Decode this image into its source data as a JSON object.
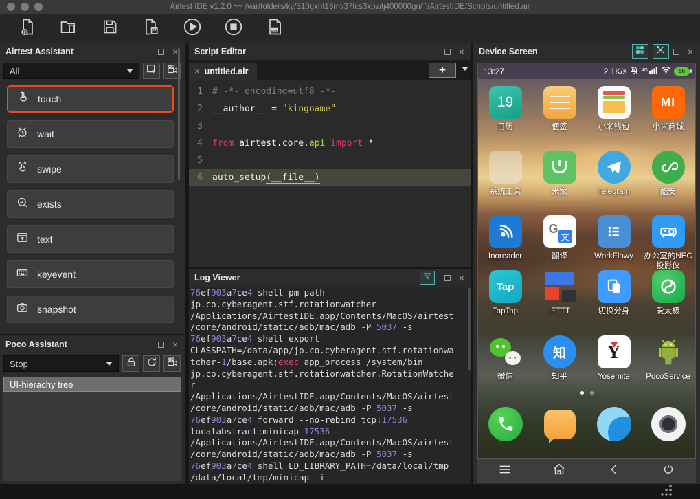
{
  "window": {
    "title": "Airtest IDE v1.2.0 ~~ /var/folders/ky/310gxhf13mv37tcs3xbwtj400000gn/T/AirtestIDE/Scripts/untitled.air"
  },
  "toolbar": {
    "buttons": [
      "new-script",
      "open-script",
      "save-script",
      "save-script-as",
      "run-script",
      "stop-script",
      "show-log"
    ]
  },
  "airtest_assistant": {
    "title": "Airtest Assistant",
    "filter_value": "All",
    "items": [
      {
        "label": "touch",
        "icon": "touch-icon",
        "highlighted": true
      },
      {
        "label": "wait",
        "icon": "wait-icon",
        "highlighted": false
      },
      {
        "label": "swipe",
        "icon": "swipe-icon",
        "highlighted": false
      },
      {
        "label": "exists",
        "icon": "exists-icon",
        "highlighted": false
      },
      {
        "label": "text",
        "icon": "text-icon",
        "highlighted": false
      },
      {
        "label": "keyevent",
        "icon": "keyevent-icon",
        "highlighted": false
      },
      {
        "label": "snapshot",
        "icon": "snapshot-icon",
        "highlighted": false
      }
    ]
  },
  "poco_assistant": {
    "title": "Poco Assistant",
    "mode_value": "Stop",
    "tree_header": "UI-hierachy tree"
  },
  "script_editor": {
    "title": "Script Editor",
    "tab_label": "untitled.air",
    "code": [
      {
        "num": "1",
        "current": false,
        "segs": [
          {
            "c": "cmt",
            "t": "# -*- encoding=utf8 -*-"
          }
        ]
      },
      {
        "num": "2",
        "current": false,
        "segs": [
          {
            "c": "pln",
            "t": "__author__ = "
          },
          {
            "c": "str",
            "t": "\"kingname\""
          }
        ]
      },
      {
        "num": "3",
        "current": false,
        "segs": []
      },
      {
        "num": "4",
        "current": false,
        "segs": [
          {
            "c": "kw",
            "t": "from"
          },
          {
            "c": "pln",
            "t": " airtest.core."
          },
          {
            "c": "fn",
            "t": "api"
          },
          {
            "c": "pln",
            "t": " "
          },
          {
            "c": "kw",
            "t": "import"
          },
          {
            "c": "pln",
            "t": " *"
          }
        ]
      },
      {
        "num": "5",
        "current": false,
        "segs": []
      },
      {
        "num": "6",
        "current": true,
        "segs": [
          {
            "c": "pln",
            "t": "auto_setup"
          },
          {
            "c": "pln u",
            "t": "(__file__)"
          }
        ]
      }
    ]
  },
  "log_viewer": {
    "title": "Log Viewer",
    "lines": [
      "76ef903a7ce4 shell pm path",
      "jp.co.cyberagent.stf.rotationwatcher",
      "/Applications/AirtestIDE.app/Contents/MacOS/airtest",
      "/core/android/static/adb/mac/adb -P 5037 -s",
      "76ef903a7ce4 shell export",
      "CLASSPATH=/data/app/jp.co.cyberagent.stf.rotationwa",
      "tcher-1/base.apk;exec app_process /system/bin",
      "jp.co.cyberagent.stf.rotationwatcher.RotationWatche",
      "r",
      "/Applications/AirtestIDE.app/Contents/MacOS/airtest",
      "/core/android/static/adb/mac/adb -P 5037 -s",
      "76ef903a7ce4 forward --no-rebind tcp:17536",
      "localabstract:minicap_17536",
      "/Applications/AirtestIDE.app/Contents/MacOS/airtest",
      "/core/android/static/adb/mac/adb -P 5037 -s",
      "76ef903a7ce4 shell LD_LIBRARY_PATH=/data/local/tmp",
      "/data/local/tmp/minicap -i"
    ]
  },
  "device_screen": {
    "title": "Device Screen",
    "status": {
      "time": "13:27",
      "net_speed": "2.1K/s",
      "network_label": "4G",
      "battery_percent": "56"
    },
    "app_rows": [
      [
        {
          "label": "日历",
          "icon": "calendar"
        },
        {
          "label": "便签",
          "icon": "notes"
        },
        {
          "label": "小米钱包",
          "icon": "mi-wallet"
        },
        {
          "label": "小米商城",
          "icon": "mi-store"
        }
      ],
      [
        {
          "label": "系统工具",
          "icon": "folder"
        },
        {
          "label": "米家",
          "icon": "mi-home"
        },
        {
          "label": "Telegram",
          "icon": "telegram"
        },
        {
          "label": "酷安",
          "icon": "coolapk"
        }
      ],
      [
        {
          "label": "Inoreader",
          "icon": "inoreader"
        },
        {
          "label": "翻译",
          "icon": "translate"
        },
        {
          "label": "WorkFlowy",
          "icon": "workflowy"
        },
        {
          "label": "办公室的NEC投影仪",
          "icon": "projector"
        }
      ],
      [
        {
          "label": "TapTap",
          "icon": "taptap"
        },
        {
          "label": "IFTTT",
          "icon": "ifttt"
        },
        {
          "label": "切换分身",
          "icon": "clone"
        },
        {
          "label": "爱太极",
          "icon": "taichi"
        }
      ],
      [
        {
          "label": "微信",
          "icon": "wechat"
        },
        {
          "label": "知乎",
          "icon": "zhihu"
        },
        {
          "label": "Yosemite",
          "icon": "yosemite"
        },
        {
          "label": "PocoService",
          "icon": "pocoservice"
        }
      ]
    ],
    "icon_texts": {
      "calendar_day": "19",
      "mi_store_logo": "MI",
      "taptap_logo": "Tap",
      "zhihu_logo": "知",
      "yosemite_logo": "Y",
      "translate_g": "G",
      "translate_char": "文"
    },
    "dock": [
      {
        "icon": "phone"
      },
      {
        "icon": "sms"
      },
      {
        "icon": "browser"
      },
      {
        "icon": "camera"
      }
    ],
    "nav": [
      {
        "icon": "menu"
      },
      {
        "icon": "home"
      },
      {
        "icon": "back"
      },
      {
        "icon": "power"
      }
    ]
  },
  "colors": {
    "accent_highlight": "#f0491f",
    "teal_accent": "#4db6ac",
    "battery_green": "#5ec934",
    "keyword_pink": "#f72f6c",
    "string_yellow": "#d8d054",
    "function_green": "#a2df3a",
    "log_number_purple": "#8f7fd8",
    "log_exec_pink": "#f0467a"
  }
}
